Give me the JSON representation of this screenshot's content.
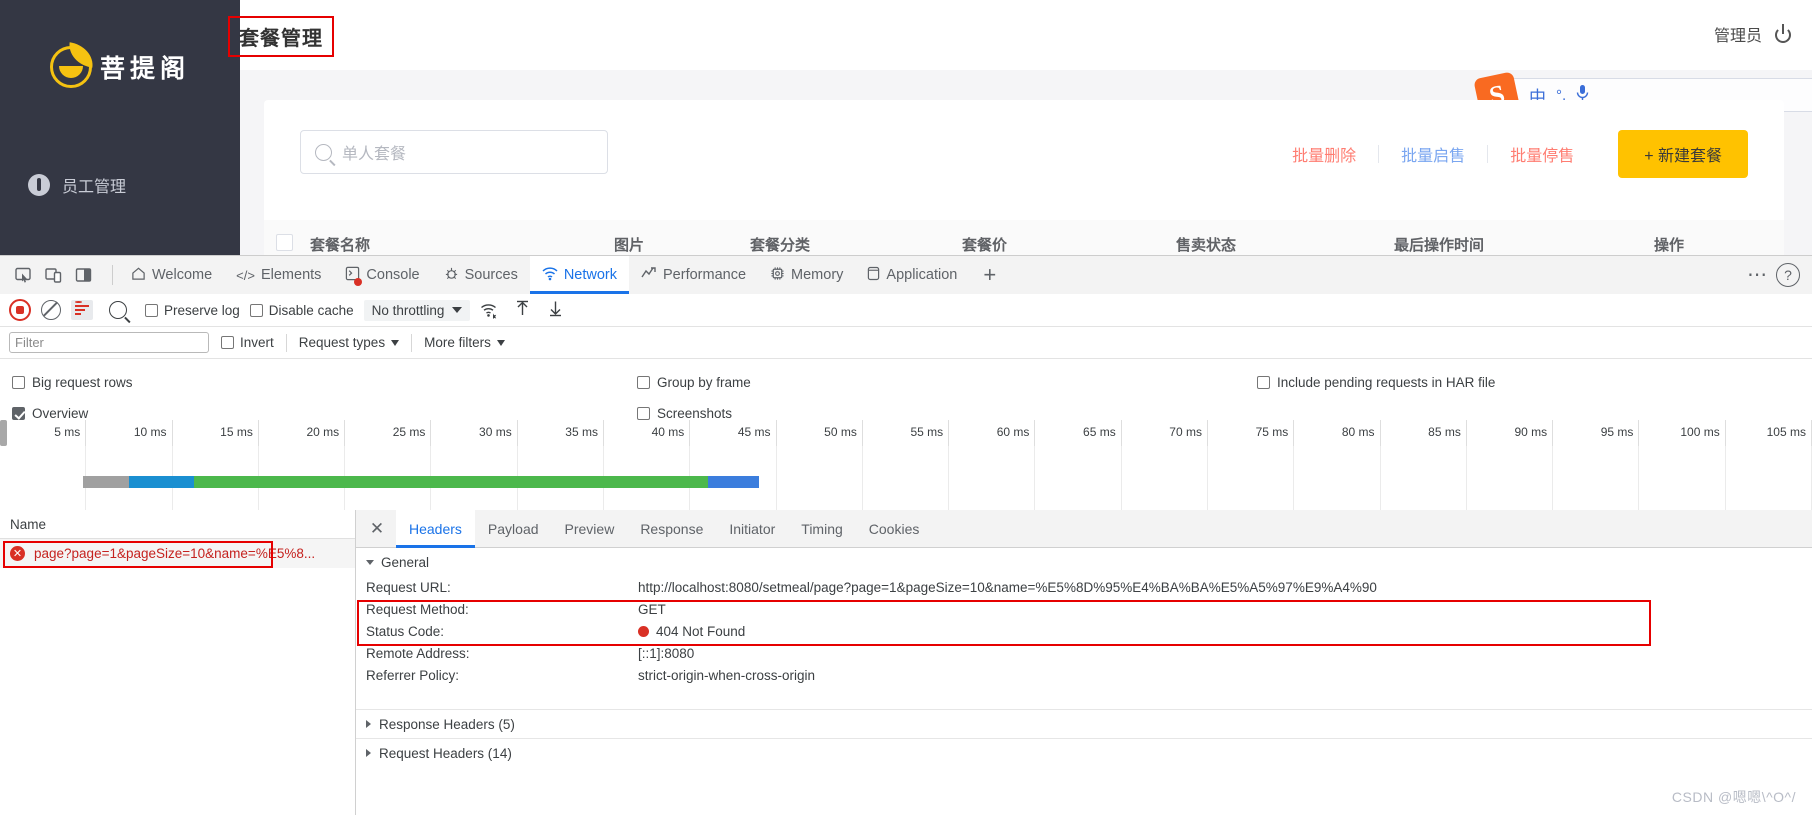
{
  "webapp": {
    "brand": "菩提阁",
    "sidebar_items": [
      {
        "label": "员工管理",
        "icon": "person-tie-icon"
      }
    ],
    "page_title": "套餐管理",
    "user": "管理员",
    "logout_icon": "power-icon",
    "ime": {
      "lang": "中",
      "punct": "°,",
      "mic": "mic-icon",
      "logo": "S"
    },
    "search_placeholder": "单人套餐",
    "buttons": {
      "batch_delete": "批量删除",
      "batch_enable": "批量启售",
      "batch_disable": "批量停售",
      "new_setmeal": "+ 新建套餐"
    },
    "table_headers": [
      "套餐名称",
      "图片",
      "套餐分类",
      "套餐价",
      "售卖状态",
      "最后操作时间",
      "操作"
    ]
  },
  "devtools": {
    "panels": [
      {
        "label": "Welcome",
        "icon": "home-icon",
        "active": false
      },
      {
        "label": "Elements",
        "icon": "code-icon",
        "active": false
      },
      {
        "label": "Console",
        "icon": "console-icon",
        "active": false
      },
      {
        "label": "Sources",
        "icon": "sources-icon",
        "active": false
      },
      {
        "label": "Network",
        "icon": "network-icon",
        "active": true
      },
      {
        "label": "Performance",
        "icon": "performance-icon",
        "active": false
      },
      {
        "label": "Memory",
        "icon": "memory-icon",
        "active": false
      },
      {
        "label": "Application",
        "icon": "application-icon",
        "active": false
      }
    ],
    "add_tab": "+",
    "more_options": "⋯",
    "help": "?",
    "dock_icons": [
      "inspect-icon",
      "device-toolbar-icon",
      "dock-side-icon"
    ],
    "toolbar": {
      "record_icon": "record-icon",
      "clear_icon": "clear-icon",
      "filter_icon": "filter-icon",
      "search_icon": "search-icon",
      "preserve_log": "Preserve log",
      "preserve_log_checked": false,
      "disable_cache": "Disable cache",
      "disable_cache_checked": false,
      "throttling": "No throttling",
      "network_conditions_icon": "network-conditions-icon",
      "import_har_icon": "import-har-icon",
      "export_har_icon": "export-har-icon"
    },
    "filterbar": {
      "filter_placeholder": "Filter",
      "filter_value": "",
      "invert": "Invert",
      "invert_checked": false,
      "request_types": "Request types",
      "more_filters": "More filters"
    },
    "settings": {
      "big_request_rows": "Big request rows",
      "big_request_rows_checked": false,
      "overview": "Overview",
      "overview_checked": true,
      "group_by_frame": "Group by frame",
      "group_by_frame_checked": false,
      "screenshots": "Screenshots",
      "screenshots_checked": false,
      "include_pending": "Include pending requests in HAR file",
      "include_pending_checked": false
    },
    "overview_ticks": [
      "5 ms",
      "10 ms",
      "15 ms",
      "20 ms",
      "25 ms",
      "30 ms",
      "35 ms",
      "40 ms",
      "45 ms",
      "50 ms",
      "55 ms",
      "60 ms",
      "65 ms",
      "70 ms",
      "75 ms",
      "80 ms",
      "85 ms",
      "90 ms",
      "95 ms",
      "100 ms",
      "105 ms"
    ],
    "overview_bands": [
      {
        "color": "#a0a0a0",
        "start_pct": 4.6,
        "width_pct": 2.5
      },
      {
        "color": "#1a8fd1",
        "start_pct": 7.1,
        "width_pct": 3.6
      },
      {
        "color": "#4cb84c",
        "start_pct": 10.7,
        "width_pct": 28.4
      },
      {
        "color": "#3b7ddd",
        "start_pct": 39.1,
        "width_pct": 2.8
      }
    ],
    "name_column_header": "Name",
    "requests": [
      {
        "name": "page?page=1&pageSize=10&name=%E5%8...",
        "status": "error"
      }
    ],
    "detail_tabs": [
      {
        "label": "Headers",
        "active": true
      },
      {
        "label": "Payload",
        "active": false
      },
      {
        "label": "Preview",
        "active": false
      },
      {
        "label": "Response",
        "active": false
      },
      {
        "label": "Initiator",
        "active": false
      },
      {
        "label": "Timing",
        "active": false
      },
      {
        "label": "Cookies",
        "active": false
      }
    ],
    "general": {
      "section_label": "General",
      "rows": [
        {
          "key": "Request URL:",
          "value": "http://localhost:8080/setmeal/page?page=1&pageSize=10&name=%E5%8D%95%E4%BA%BA%E5%A5%97%E9%A4%90"
        },
        {
          "key": "Request Method:",
          "value": "GET"
        },
        {
          "key": "Status Code:",
          "value": "404 Not Found"
        },
        {
          "key": "Remote Address:",
          "value": "[::1]:8080"
        },
        {
          "key": "Referrer Policy:",
          "value": "strict-origin-when-cross-origin"
        }
      ]
    },
    "collapsed_sections": [
      {
        "label": "Response Headers (5)"
      },
      {
        "label": "Request Headers (14)"
      }
    ]
  },
  "watermark": "CSDN @嗯嗯\\^O^/",
  "colors": {
    "accent": "#1a73e8",
    "brand_yellow": "#ffc200",
    "error_red": "#d93025",
    "highlight_red": "#e60000",
    "sidebar_bg": "#343744"
  }
}
